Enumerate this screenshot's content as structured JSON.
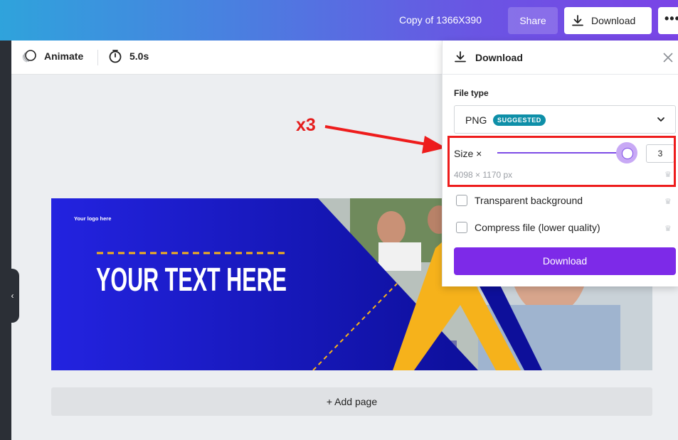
{
  "header": {
    "doc_title": "Copy of 1366X390",
    "share_label": "Share",
    "download_label": "Download",
    "more_label": "•••"
  },
  "toolbar": {
    "animate_label": "Animate",
    "duration": "5.0s"
  },
  "design": {
    "logo_text": "Your logo here",
    "headline": "YOUR TEXT HERE"
  },
  "canvas": {
    "add_page_label": "+ Add page"
  },
  "annotation": {
    "label": "x3"
  },
  "download_panel": {
    "title": "Download",
    "file_type_label": "File type",
    "file_type_value": "PNG",
    "suggested_badge": "SUGGESTED",
    "size_label": "Size ×",
    "size_value": "3",
    "size_fraction": 0.97,
    "size_pixels": "4098 × 1170 px",
    "transparent_label": "Transparent background",
    "compress_label": "Compress file (lower quality)",
    "download_button": "Download"
  },
  "colors": {
    "accent": "#7d2ae8",
    "badge": "#0e8fa8",
    "annotation": "#ee1c1c",
    "design_blue": "#1a16c8",
    "design_yellow": "#f6b21b"
  }
}
